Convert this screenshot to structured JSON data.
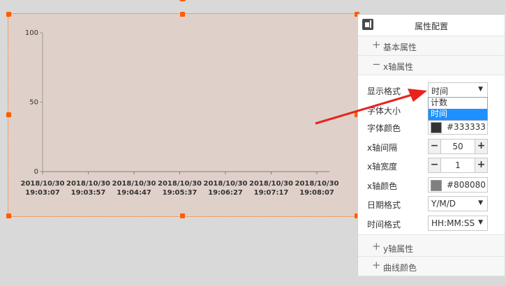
{
  "panel": {
    "title": "属性配置",
    "sections": {
      "basic": {
        "sign": "+",
        "label": "基本属性"
      },
      "xaxis": {
        "sign": "−",
        "label": "x轴属性"
      },
      "yaxis": {
        "sign": "+",
        "label": "y轴属性"
      },
      "curve": {
        "sign": "+",
        "label": "曲线颜色"
      }
    },
    "xaxis": {
      "display_format": {
        "label": "显示格式",
        "value": "时间",
        "options": [
          "计数",
          "时间"
        ],
        "selected_option": "时间"
      },
      "font_size": {
        "label": "字体大小"
      },
      "font_color": {
        "label": "字体颜色",
        "value": "#333333",
        "swatch": "#333333"
      },
      "interval": {
        "label": "x轴间隔",
        "value": "50",
        "minus": "−",
        "plus": "+"
      },
      "width": {
        "label": "x轴宽度",
        "value": "1",
        "minus": "−",
        "plus": "+"
      },
      "axis_color": {
        "label": "x轴颜色",
        "value": "#808080",
        "swatch": "#808080"
      },
      "date_format": {
        "label": "日期格式",
        "value": "Y/M/D"
      },
      "time_format": {
        "label": "时间格式",
        "value": "HH:MM:SS"
      }
    },
    "dropdown_arrow": "▼"
  },
  "canvas": {
    "selection_color": "#ff5c00",
    "chart_bg": "#dfd1ca",
    "rotate_icon": "rotate-icon"
  },
  "chart_data": {
    "type": "line",
    "title": "",
    "xlabel": "",
    "ylabel": "",
    "ylim": [
      0,
      100
    ],
    "yticks": [
      0,
      50,
      100
    ],
    "x": [
      [
        "2018/10/30",
        "19:03:07"
      ],
      [
        "2018/10/30",
        "19:03:57"
      ],
      [
        "2018/10/30",
        "19:04:47"
      ],
      [
        "2018/10/30",
        "19:05:37"
      ],
      [
        "2018/10/30",
        "19:06:27"
      ],
      [
        "2018/10/30",
        "19:07:17"
      ],
      [
        "2018/10/30",
        "19:08:07"
      ]
    ],
    "series": [],
    "grid": false,
    "axis_color": "#808080"
  }
}
